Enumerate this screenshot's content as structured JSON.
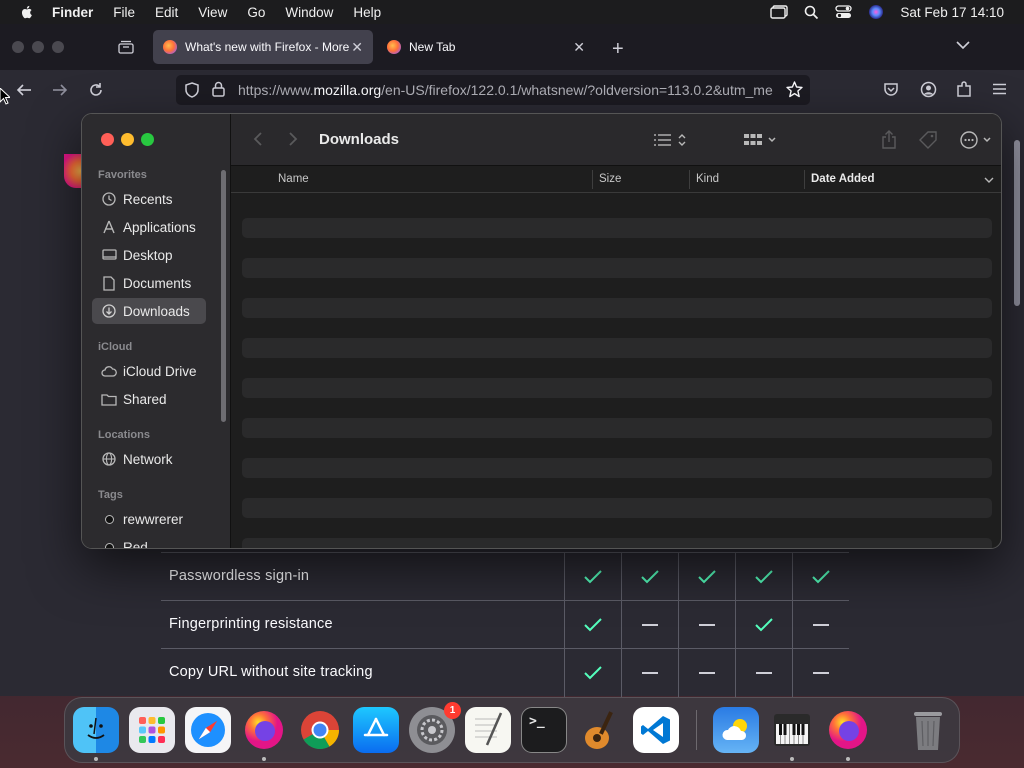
{
  "menubar": {
    "app_name": "Finder",
    "items": [
      "File",
      "Edit",
      "View",
      "Go",
      "Window",
      "Help"
    ],
    "clock": "Sat Feb 17  14:10"
  },
  "browser": {
    "tabs": [
      {
        "title": "What's new with Firefox - More"
      },
      {
        "title": "New Tab"
      }
    ],
    "url_prefix": "https://www.",
    "url_domain": "mozilla.org",
    "url_rest": "/en-US/firefox/122.0.1/whatsnew/?oldversion=113.0.2&utm_me",
    "page_rows": [
      {
        "feature": "Passwordless sign-in",
        "cells": [
          "check",
          "check",
          "check",
          "check",
          "check"
        ]
      },
      {
        "feature": "Fingerprinting resistance",
        "cells": [
          "check",
          "dash",
          "dash",
          "check",
          "dash"
        ]
      },
      {
        "feature": "Copy URL without site tracking",
        "cells": [
          "check",
          "dash",
          "dash",
          "dash",
          "dash"
        ]
      }
    ],
    "check_color": "#54ffbd"
  },
  "finder": {
    "title": "Downloads",
    "sidebar": {
      "favorites_label": "Favorites",
      "favorites": [
        "Recents",
        "Applications",
        "Desktop",
        "Documents",
        "Downloads"
      ],
      "icloud_label": "iCloud",
      "icloud": [
        "iCloud Drive",
        "Shared"
      ],
      "locations_label": "Locations",
      "locations": [
        "Network"
      ],
      "tags_label": "Tags",
      "tags": [
        "rewwrerer",
        "Red"
      ]
    },
    "columns": {
      "name": "Name",
      "size": "Size",
      "kind": "Kind",
      "date_added": "Date Added"
    }
  },
  "dock": {
    "apps": [
      "Finder",
      "Launchpad",
      "Safari",
      "Firefox",
      "Chrome",
      "App Store",
      "System Settings",
      "TextEdit",
      "Terminal",
      "GarageBand",
      "Visual Studio Code",
      "Weather",
      "Piano",
      "Firefox",
      "Trash"
    ],
    "system_settings_badge": "1"
  }
}
